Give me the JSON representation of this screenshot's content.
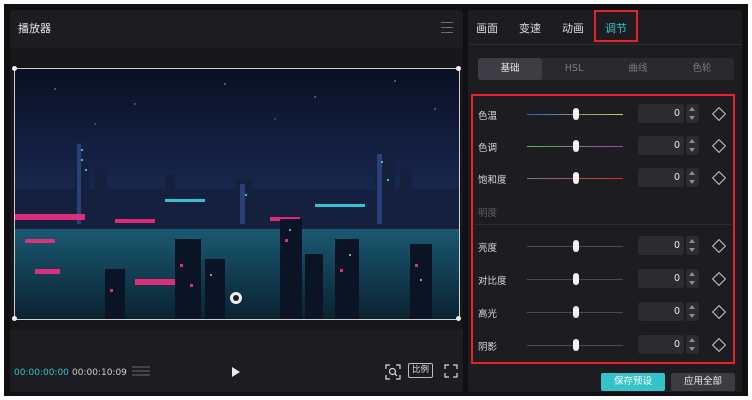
{
  "player": {
    "title": "播放器",
    "time_current": "00:00:00:00",
    "time_total": "00:00:10:09",
    "ratio_label": "比例"
  },
  "panel": {
    "tabs": [
      {
        "label": "画面"
      },
      {
        "label": "变速"
      },
      {
        "label": "动画"
      },
      {
        "label": "调节",
        "active": true
      }
    ],
    "subtabs": [
      {
        "label": "基础",
        "active": true
      },
      {
        "label": "HSL"
      },
      {
        "label": "曲线"
      },
      {
        "label": "色轮"
      }
    ],
    "color_rows": [
      {
        "label": "色温",
        "value": "0"
      },
      {
        "label": "色调",
        "value": "0"
      },
      {
        "label": "饱和度",
        "value": "0"
      }
    ],
    "brightness_section": "明度",
    "light_rows": [
      {
        "label": "亮度",
        "value": "0"
      },
      {
        "label": "对比度",
        "value": "0"
      },
      {
        "label": "高光",
        "value": "0"
      },
      {
        "label": "阴影",
        "value": "0"
      }
    ],
    "save_preset": "保存预设",
    "apply_all": "应用全部"
  },
  "colors": {
    "accent": "#35c2c9",
    "highlight": "#e8212c",
    "background": "#1d1d21"
  },
  "icons": [
    "menu-icon",
    "play-icon",
    "fit-icon",
    "fullscreen-icon",
    "keyframe-diamond-icon",
    "stepper-icon",
    "rotate-handle-icon",
    "timeline-bars-icon"
  ]
}
